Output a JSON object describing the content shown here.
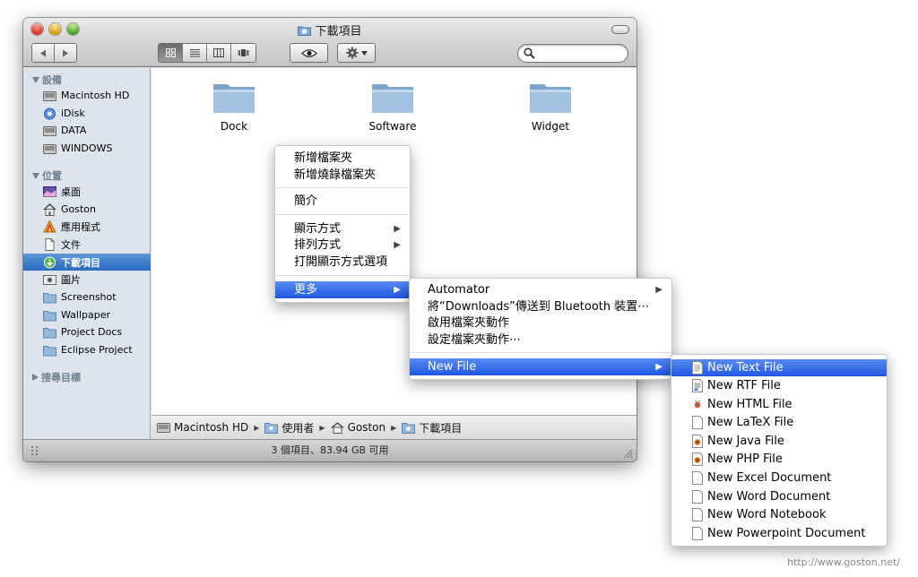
{
  "window": {
    "title": "下載項目",
    "status": "3 個項目、83.94 GB 可用"
  },
  "sidebar": {
    "devices_header": "設備",
    "devices": [
      {
        "label": "Macintosh HD",
        "icon": "hard-drive-icon"
      },
      {
        "label": "iDisk",
        "icon": "idisk-icon"
      },
      {
        "label": "DATA",
        "icon": "hard-drive-icon"
      },
      {
        "label": "WINDOWS",
        "icon": "hard-drive-icon"
      }
    ],
    "places_header": "位置",
    "places": [
      {
        "label": "桌面",
        "icon": "desktop-icon"
      },
      {
        "label": "Goston",
        "icon": "home-icon"
      },
      {
        "label": "應用程式",
        "icon": "applications-icon"
      },
      {
        "label": "文件",
        "icon": "document-icon"
      },
      {
        "label": "下載項目",
        "icon": "downloads-icon",
        "selected": true
      },
      {
        "label": "圖片",
        "icon": "pictures-icon"
      },
      {
        "label": "Screenshot",
        "icon": "folder-icon"
      },
      {
        "label": "Wallpaper",
        "icon": "folder-icon"
      },
      {
        "label": "Project Docs",
        "icon": "folder-icon"
      },
      {
        "label": "Eclipse Project",
        "icon": "folder-icon"
      }
    ],
    "search_header": "搜尋目標"
  },
  "folders": [
    {
      "label": "Dock"
    },
    {
      "label": "Software"
    },
    {
      "label": "Widget"
    }
  ],
  "pathbar": {
    "items": [
      "Macintosh HD",
      "使用者",
      "Goston",
      "下載項目"
    ]
  },
  "context_menu": {
    "items": [
      "新增檔案夾",
      "新增燒錄檔案夾",
      "簡介",
      "顯示方式",
      "排列方式",
      "打開顯示方式選項",
      "更多"
    ],
    "highlighted": "更多"
  },
  "more_submenu": {
    "items": [
      "Automator",
      "將“Downloads”傳送到 Bluetooth 裝置⋯",
      "啟用檔案夾動作",
      "設定檔案夾動作⋯",
      "New File"
    ],
    "highlighted": "New File"
  },
  "newfile_submenu": {
    "items": [
      {
        "label": "New Text File",
        "icon": "text-file-icon"
      },
      {
        "label": "New RTF File",
        "icon": "rtf-file-icon"
      },
      {
        "label": "New HTML File",
        "icon": "html-file-icon"
      },
      {
        "label": "New LaTeX File",
        "icon": "latex-file-icon"
      },
      {
        "label": "New Java File",
        "icon": "java-file-icon"
      },
      {
        "label": "New PHP File",
        "icon": "php-file-icon"
      },
      {
        "label": "New Excel Document",
        "icon": "excel-file-icon"
      },
      {
        "label": "New Word Document",
        "icon": "word-file-icon"
      },
      {
        "label": "New Word Notebook",
        "icon": "word-notebook-icon"
      },
      {
        "label": "New Powerpoint Document",
        "icon": "powerpoint-file-icon"
      }
    ],
    "highlighted": "New Text File"
  },
  "watermark": "http://www.goston.net/",
  "colors": {
    "menu_highlight": "#2a62e6",
    "sidebar_bg": "#dde4ec",
    "sidebar_selected": "#3a7bd0",
    "folder_blue": "#8fb2d6"
  }
}
